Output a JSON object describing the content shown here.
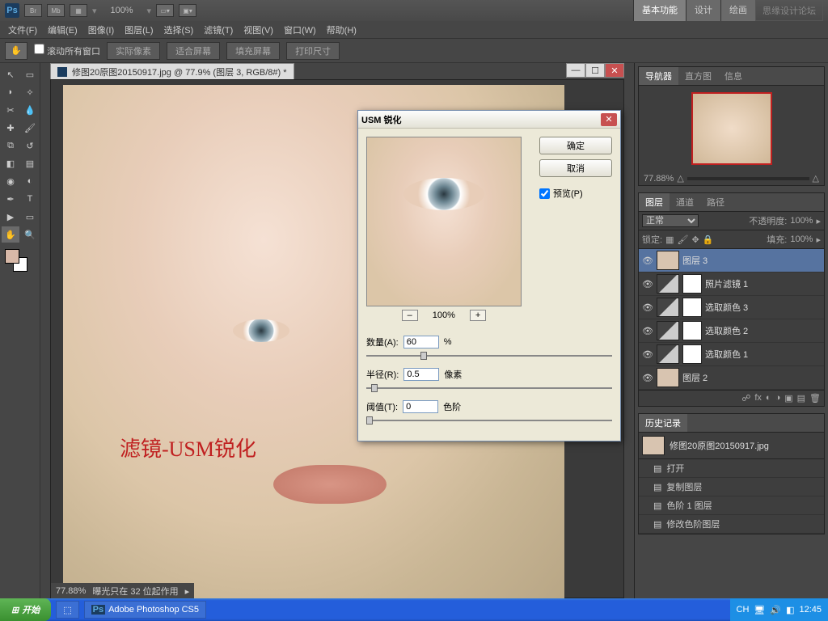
{
  "top": {
    "app_icon": "Ps",
    "modes": [
      "Br",
      "Mb"
    ],
    "zoom": "100%",
    "workspace_tabs": [
      "基本功能",
      "设计",
      "绘画"
    ],
    "watermark": "思缘设计论坛"
  },
  "menu": [
    "文件(F)",
    "编辑(E)",
    "图像(I)",
    "图层(L)",
    "选择(S)",
    "滤镜(T)",
    "视图(V)",
    "窗口(W)",
    "帮助(H)"
  ],
  "options": {
    "scroll_all": "滚动所有窗口",
    "buttons": [
      "实际像素",
      "适合屏幕",
      "填充屏幕",
      "打印尺寸"
    ]
  },
  "document": {
    "title": "修图20原图20150917.jpg @ 77.9% (图层 3, RGB/8#) *",
    "annotation": "滤镜-USM锐化",
    "status_zoom": "77.88%",
    "status_text": "曝光只在 32 位起作用"
  },
  "dialog": {
    "title": "USM 锐化",
    "ok": "确定",
    "cancel": "取消",
    "preview_label": "预览(P)",
    "zoom": "100%",
    "params": {
      "amount_label": "数量(A):",
      "amount_value": "60",
      "amount_unit": "%",
      "radius_label": "半径(R):",
      "radius_value": "0.5",
      "radius_unit": "像素",
      "threshold_label": "阈值(T):",
      "threshold_value": "0",
      "threshold_unit": "色阶"
    }
  },
  "navigator": {
    "tabs": [
      "导航器",
      "直方图",
      "信息"
    ],
    "zoom": "77.88%"
  },
  "layers_panel": {
    "tabs": [
      "图层",
      "通道",
      "路径"
    ],
    "blend": "正常",
    "opacity_label": "不透明度:",
    "opacity": "100%",
    "lock_label": "锁定:",
    "fill_label": "填充:",
    "fill": "100%",
    "layers": [
      {
        "name": "图层 3",
        "type": "img",
        "selected": true
      },
      {
        "name": "照片滤镜 1",
        "type": "adj"
      },
      {
        "name": "选取颜色 3",
        "type": "adj"
      },
      {
        "name": "选取颜色 2",
        "type": "adj"
      },
      {
        "name": "选取颜色 1",
        "type": "adj"
      },
      {
        "name": "图层 2",
        "type": "img"
      }
    ]
  },
  "history": {
    "tab": "历史记录",
    "doc": "修图20原图20150917.jpg",
    "steps": [
      "打开",
      "复制图层",
      "色阶 1 图层",
      "修改色阶图层"
    ]
  },
  "taskbar": {
    "start": "开始",
    "task": "Adobe Photoshop CS5",
    "lang": "CH",
    "time": "12:45"
  }
}
